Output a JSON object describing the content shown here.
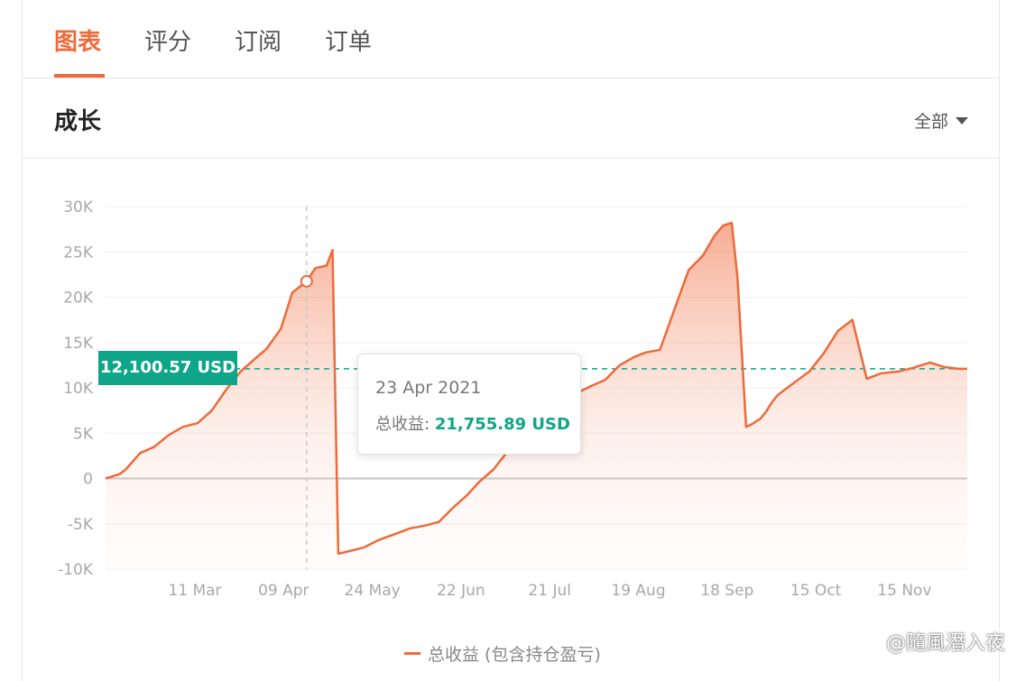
{
  "tabs": [
    {
      "label": "图表",
      "active": true
    },
    {
      "label": "评分",
      "active": false
    },
    {
      "label": "订阅",
      "active": false
    },
    {
      "label": "订单",
      "active": false
    }
  ],
  "section": {
    "title": "成长",
    "filter_label": "全部"
  },
  "chart_data": {
    "type": "area",
    "y_ticks": [
      "30K",
      "25K",
      "20K",
      "15K",
      "10K",
      "5K",
      "0",
      "-5K",
      "-10K"
    ],
    "ylim": [
      -10000,
      30000
    ],
    "x_ticks": [
      "11 Mar",
      "09 Apr",
      "24 May",
      "22 Jun",
      "21 Jul",
      "19 Aug",
      "18 Sep",
      "15 Oct",
      "15 Nov"
    ],
    "series": [
      {
        "name": "总收益 (包含持仓盈亏)",
        "color": "#ee6a3a",
        "x": [
          "2021-02-12",
          "2021-02-17",
          "2021-02-19",
          "2021-02-24",
          "2021-03-01",
          "2021-03-06",
          "2021-03-11",
          "2021-03-16",
          "2021-03-21",
          "2021-03-26",
          "2021-03-31",
          "2021-04-05",
          "2021-04-09",
          "2021-04-14",
          "2021-04-18",
          "2021-04-23",
          "2021-04-26",
          "2021-04-30",
          "2021-05-02",
          "2021-05-04",
          "2021-05-08",
          "2021-05-13",
          "2021-05-18",
          "2021-05-24",
          "2021-05-29",
          "2021-06-03",
          "2021-06-08",
          "2021-06-13",
          "2021-06-18",
          "2021-06-22",
          "2021-06-27",
          "2021-07-02",
          "2021-07-07",
          "2021-07-11",
          "2021-07-16",
          "2021-07-21",
          "2021-07-26",
          "2021-07-31",
          "2021-08-05",
          "2021-08-10",
          "2021-08-15",
          "2021-08-19",
          "2021-08-24",
          "2021-08-29",
          "2021-09-03",
          "2021-09-08",
          "2021-09-12",
          "2021-09-15",
          "2021-09-18",
          "2021-09-20",
          "2021-09-23",
          "2021-09-25",
          "2021-09-28",
          "2021-09-30",
          "2021-10-02",
          "2021-10-04",
          "2021-10-09",
          "2021-10-15",
          "2021-10-20",
          "2021-10-25",
          "2021-10-30",
          "2021-11-04",
          "2021-11-09",
          "2021-11-15",
          "2021-11-20",
          "2021-11-24",
          "2021-11-26",
          "2021-12-01",
          "2021-12-06",
          "2021-12-09"
        ],
        "values": [
          0,
          500,
          1000,
          2800,
          3500,
          4800,
          5700,
          6100,
          7500,
          9800,
          11800,
          13200,
          14300,
          16500,
          20500,
          21755.89,
          23200,
          23500,
          25200,
          -8300,
          -8000,
          -7600,
          -6800,
          -6100,
          -5500,
          -5200,
          -4800,
          -3200,
          -1800,
          -400,
          1000,
          3000,
          5500,
          7800,
          8600,
          8900,
          9400,
          10200,
          10900,
          12500,
          13400,
          13900,
          14200,
          18600,
          23000,
          24600,
          26800,
          27900,
          28200,
          22200,
          5700,
          6000,
          6600,
          7400,
          8400,
          9200,
          10400,
          11800,
          13800,
          16300,
          17500,
          11000,
          11600,
          11800,
          12200,
          12600,
          12800,
          12300,
          12100.57,
          12100.57
        ],
        "last_value_label": "12,100.57 USD"
      }
    ],
    "tooltip": {
      "date": "23 Apr 2021",
      "label": "总收益:",
      "value": "21,755.89 USD"
    },
    "grid": true,
    "legend_position": "bottom"
  },
  "watermark": "@隨風潛入夜"
}
